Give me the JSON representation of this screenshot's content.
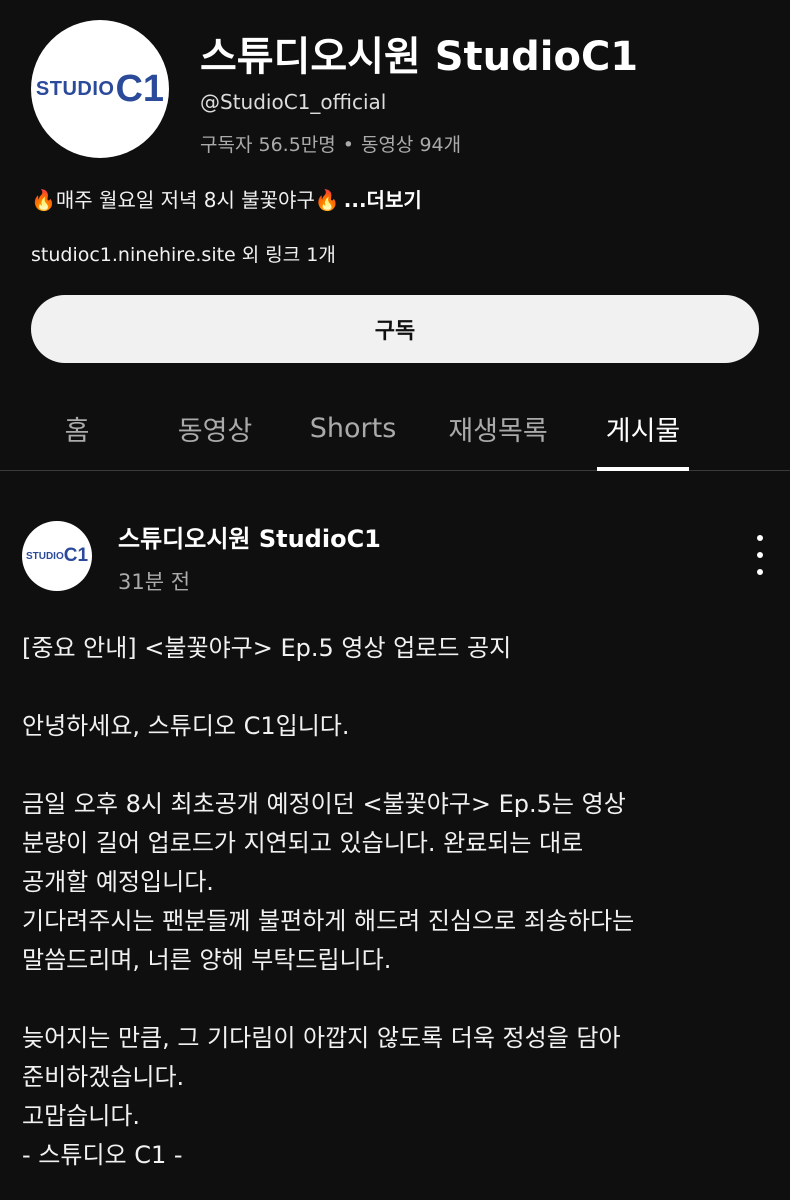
{
  "channel": {
    "logo_text": "STUDIO",
    "logo_c1": "C1",
    "name": "스튜디오시원 StudioC1",
    "handle": "@StudioC1_official",
    "subscribers": "구독자 56.5만명",
    "separator": "•",
    "video_count": "동영상 94개",
    "description": "🔥매주 월요일 저녁 8시 불꽃야구🔥",
    "more_label": "...더보기",
    "links": "studioc1.ninehire.site 외 링크 1개",
    "subscribe_label": "구독"
  },
  "tabs": [
    {
      "label": "홈"
    },
    {
      "label": "동영상"
    },
    {
      "label": "Shorts"
    },
    {
      "label": "재생목록"
    },
    {
      "label": "게시물",
      "active": true
    }
  ],
  "post": {
    "author": "스튜디오시원 StudioC1",
    "time": "31분 전",
    "lines": {
      "l1": "[중요 안내] <불꽃야구> Ep.5 영상 업로드 공지",
      "l2": "안녕하세요, 스튜디오 C1입니다.",
      "l3": "금일 오후 8시 최초공개 예정이던 <불꽃야구> Ep.5는 영상",
      "l4": "분량이 길어 업로드가 지연되고 있습니다. 완료되는 대로",
      "l5": "공개할 예정입니다.",
      "l6": "기다려주시는 팬분들께 불편하게 해드려 진심으로 죄송하다는",
      "l7": "말씀드리며, 너른 양해 부탁드립니다.",
      "l8": "늦어지는 만큼, 그 기다림이 아깝지 않도록 더욱 정성을 담아",
      "l9": "준비하겠습니다.",
      "l10": "고맙습니다.",
      "l11": "- 스튜디오 C1 -"
    }
  },
  "colors": {
    "background": "#0f0f0f",
    "text_primary": "#f1f1f1",
    "text_secondary": "#aaaaaa",
    "brand_blue": "#2b4a9a"
  }
}
